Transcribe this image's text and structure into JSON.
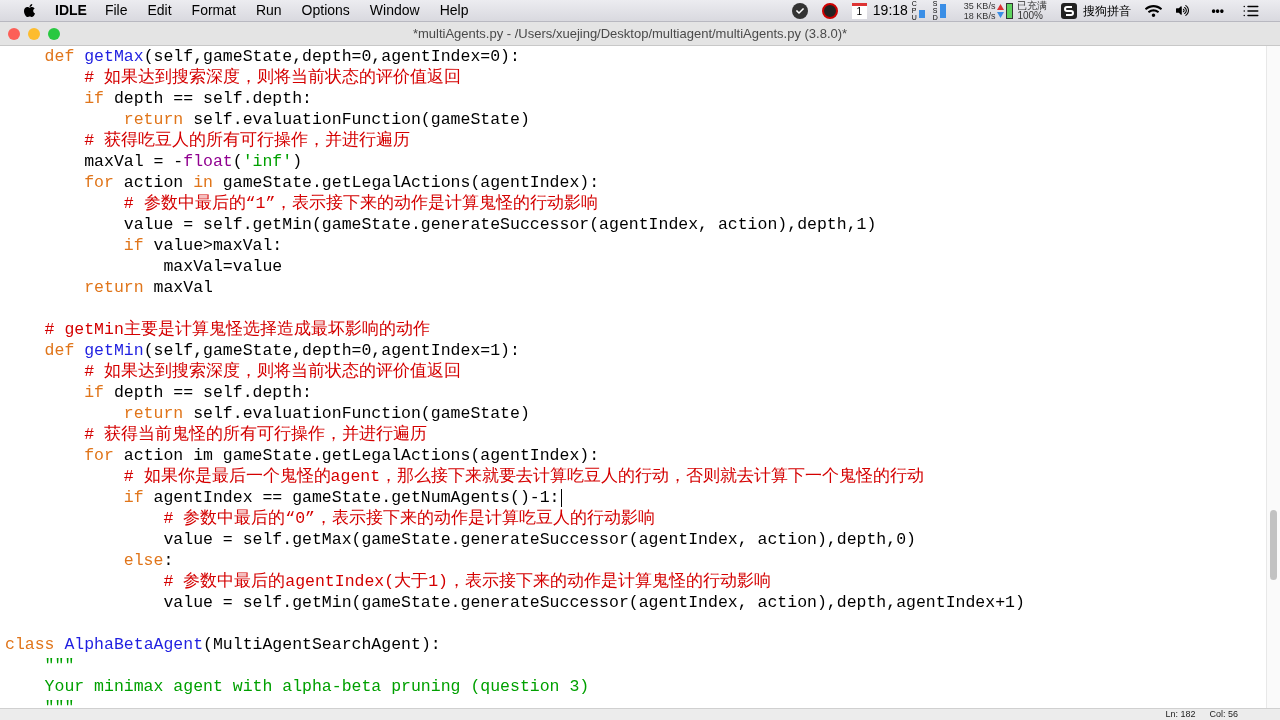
{
  "menu_bar": {
    "app_name": "IDLE",
    "menus": [
      "File",
      "Edit",
      "Format",
      "Run",
      "Options",
      "Window",
      "Help"
    ],
    "status": {
      "calendar_day": "1",
      "clock": "19:18",
      "cpu_label": "CPU",
      "ssd_label": "SSD",
      "upload": "35 KB/s",
      "download": "18 KB/s",
      "battery_state": "已充满",
      "battery_percent": "100%",
      "input_method": "搜狗拼音",
      "more": "•••"
    }
  },
  "window": {
    "title": "*multiAgents.py - /Users/xuejing/Desktop/multiagent/multiAgents.py (3.8.0)*"
  },
  "code_lines": [
    {
      "tokens": [
        {
          "kind": "keyword",
          "text": "    def"
        },
        {
          "kind": "definition",
          "text": " getMax"
        },
        {
          "kind": "plain",
          "text": "(self,gameState,depth=0,agentIndex=0):"
        }
      ]
    },
    {
      "tokens": [
        {
          "kind": "comment",
          "text": "        # 如果达到搜索深度，则将当前状态的评价值返回"
        }
      ]
    },
    {
      "tokens": [
        {
          "kind": "keyword",
          "text": "        if"
        },
        {
          "kind": "plain",
          "text": " depth == self.depth:"
        }
      ]
    },
    {
      "tokens": [
        {
          "kind": "keyword",
          "text": "            return"
        },
        {
          "kind": "plain",
          "text": " self.evaluationFunction(gameState)"
        }
      ]
    },
    {
      "tokens": [
        {
          "kind": "comment",
          "text": "        # 获得吃豆人的所有可行操作，并进行遍历"
        }
      ]
    },
    {
      "tokens": [
        {
          "kind": "plain",
          "text": "        maxVal = -"
        },
        {
          "kind": "builtin",
          "text": "float"
        },
        {
          "kind": "plain",
          "text": "("
        },
        {
          "kind": "string",
          "text": "'inf'"
        },
        {
          "kind": "plain",
          "text": ")"
        }
      ]
    },
    {
      "tokens": [
        {
          "kind": "keyword",
          "text": "        for"
        },
        {
          "kind": "plain",
          "text": " action "
        },
        {
          "kind": "keyword",
          "text": "in"
        },
        {
          "kind": "plain",
          "text": " gameState.getLegalActions(agentIndex):"
        }
      ]
    },
    {
      "tokens": [
        {
          "kind": "comment",
          "text": "            # 参数中最后的“1”，表示接下来的动作是计算鬼怪的行动影响"
        }
      ]
    },
    {
      "tokens": [
        {
          "kind": "plain",
          "text": "            value = self.getMin(gameState.generateSuccessor(agentIndex, action),depth,1)"
        }
      ]
    },
    {
      "tokens": [
        {
          "kind": "keyword",
          "text": "            if"
        },
        {
          "kind": "plain",
          "text": " value>maxVal:"
        }
      ]
    },
    {
      "tokens": [
        {
          "kind": "plain",
          "text": "                maxVal=value"
        }
      ]
    },
    {
      "tokens": [
        {
          "kind": "keyword",
          "text": "        return"
        },
        {
          "kind": "plain",
          "text": " maxVal"
        }
      ]
    },
    {
      "blank_line_before": true,
      "tokens": [
        {
          "kind": "comment",
          "text": "    # getMin主要是计算鬼怪选择造成最坏影响的动作"
        }
      ]
    },
    {
      "tokens": [
        {
          "kind": "keyword",
          "text": "    def"
        },
        {
          "kind": "definition",
          "text": " getMin"
        },
        {
          "kind": "plain",
          "text": "(self,gameState,depth=0,agentIndex=1):"
        }
      ]
    },
    {
      "tokens": [
        {
          "kind": "comment",
          "text": "        # 如果达到搜索深度，则将当前状态的评价值返回"
        }
      ]
    },
    {
      "tokens": [
        {
          "kind": "keyword",
          "text": "        if"
        },
        {
          "kind": "plain",
          "text": " depth == self.depth:"
        }
      ]
    },
    {
      "tokens": [
        {
          "kind": "keyword",
          "text": "            return"
        },
        {
          "kind": "plain",
          "text": " self.evaluationFunction(gameState)"
        }
      ]
    },
    {
      "tokens": [
        {
          "kind": "comment",
          "text": "        # 获得当前鬼怪的所有可行操作，并进行遍历"
        }
      ]
    },
    {
      "tokens": [
        {
          "kind": "keyword",
          "text": "        for"
        },
        {
          "kind": "plain",
          "text": " action im gameState.getLegalActions(agentIndex):"
        }
      ]
    },
    {
      "tokens": [
        {
          "kind": "comment",
          "text": "            # 如果你是最后一个鬼怪的agent，那么接下来就要去计算吃豆人的行动，否则就去计算下一个鬼怪的行动"
        }
      ]
    },
    {
      "tokens": [
        {
          "kind": "keyword",
          "text": "            if"
        },
        {
          "kind": "plain",
          "text": " agentIndex == gameState.getNumAgents()-1:"
        }
      ],
      "cursor": true
    },
    {
      "tokens": [
        {
          "kind": "comment",
          "text": "                # 参数中最后的“0”，表示接下来的动作是计算吃豆人的行动影响"
        }
      ]
    },
    {
      "tokens": [
        {
          "kind": "plain",
          "text": "                value = self.getMax(gameState.generateSuccessor(agentIndex, action),depth,0)"
        }
      ]
    },
    {
      "tokens": [
        {
          "kind": "keyword",
          "text": "            else"
        },
        {
          "kind": "plain",
          "text": ":"
        }
      ]
    },
    {
      "tokens": [
        {
          "kind": "comment",
          "text": "                # 参数中最后的agentIndex(大于1)，表示接下来的动作是计算鬼怪的行动影响"
        }
      ]
    },
    {
      "tokens": [
        {
          "kind": "plain",
          "text": "                value = self.getMin(gameState.generateSuccessor(agentIndex, action),depth,agentIndex+1)"
        }
      ]
    },
    {
      "blank_line_before": true,
      "tokens": [
        {
          "kind": "keyword",
          "text": "class"
        },
        {
          "kind": "definition",
          "text": " AlphaBetaAgent"
        },
        {
          "kind": "plain",
          "text": "(MultiAgentSearchAgent):"
        }
      ]
    },
    {
      "tokens": [
        {
          "kind": "string",
          "text": "    \"\"\""
        }
      ]
    },
    {
      "tokens": [
        {
          "kind": "string",
          "text": "    Your minimax agent with alpha-beta pruning (question 3)"
        }
      ]
    },
    {
      "tokens": [
        {
          "kind": "string",
          "text": "    \"\"\""
        }
      ]
    }
  ],
  "status_bar": {
    "line": "Ln: 182",
    "column": "Col: 56"
  }
}
